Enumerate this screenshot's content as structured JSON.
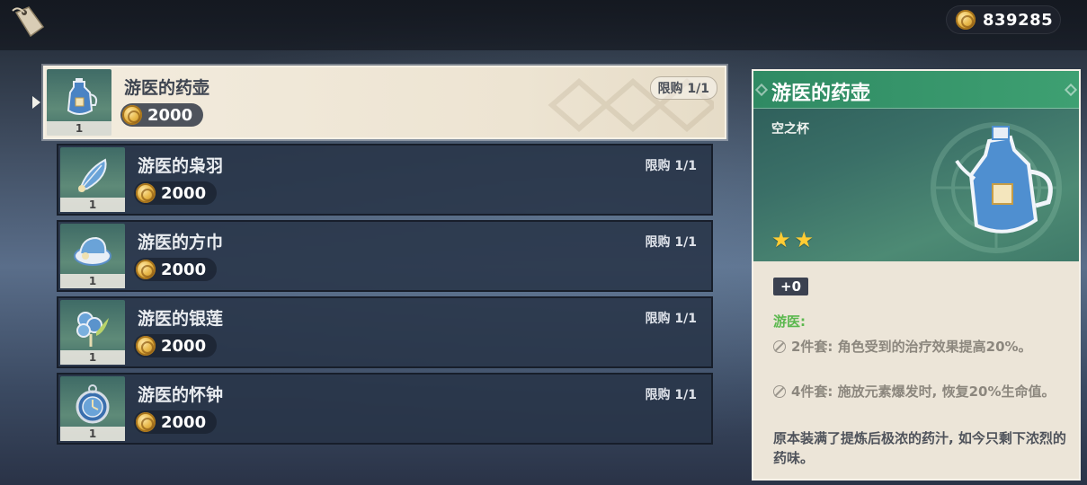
{
  "currency": {
    "amount": "839285",
    "icon": "mora-coin-icon"
  },
  "shop_list": [
    {
      "name": "游医的药壶",
      "price": "2000",
      "limit": "限购 1/1",
      "count": "1",
      "icon": "pot-icon",
      "selected": true
    },
    {
      "name": "游医的枭羽",
      "price": "2000",
      "limit": "限购 1/1",
      "count": "1",
      "icon": "feather-icon",
      "selected": false
    },
    {
      "name": "游医的方巾",
      "price": "2000",
      "limit": "限购 1/1",
      "count": "1",
      "icon": "hat-icon",
      "selected": false
    },
    {
      "name": "游医的银莲",
      "price": "2000",
      "limit": "限购 1/1",
      "count": "1",
      "icon": "flower-icon",
      "selected": false
    },
    {
      "name": "游医的怀钟",
      "price": "2000",
      "limit": "限购 1/1",
      "count": "1",
      "icon": "pocket-watch-icon",
      "selected": false
    }
  ],
  "detail": {
    "title": "游医的药壶",
    "slot": "空之杯",
    "rarity": 2,
    "stars": [
      "★",
      "★"
    ],
    "level": "+0",
    "set_name": "游医:",
    "bonus_2": "2件套: 角色受到的治疗效果提高20%。",
    "bonus_4": "4件套: 施放元素爆发时, 恢复20%生命值。",
    "description": "原本装满了提炼后极浓的药汁, 如今只剩下浓烈的药味。"
  },
  "colors": {
    "accent_green": "#3ea072",
    "set_name_green": "#5bb84e",
    "star_yellow": "#ffcc33"
  }
}
